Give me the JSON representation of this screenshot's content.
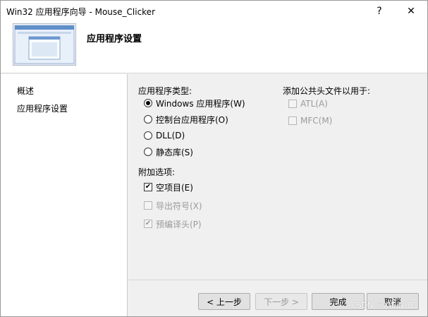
{
  "window": {
    "title": "Win32 应用程序向导 - Mouse_Clicker",
    "help_label": "?",
    "close_label": "✕"
  },
  "header": {
    "title": "应用程序设置"
  },
  "sidebar": {
    "items": [
      {
        "label": "概述"
      },
      {
        "label": "应用程序设置"
      }
    ]
  },
  "app_type": {
    "label": "应用程序类型:",
    "options": [
      {
        "label": "Windows 应用程序(W)",
        "checked": true
      },
      {
        "label": "控制台应用程序(O)",
        "checked": false
      },
      {
        "label": "DLL(D)",
        "checked": false
      },
      {
        "label": "静态库(S)",
        "checked": false
      }
    ]
  },
  "extra_options": {
    "label": "附加选项:",
    "items": [
      {
        "label": "空项目(E)",
        "checked": true,
        "enabled": true
      },
      {
        "label": "导出符号(X)",
        "checked": false,
        "enabled": false
      },
      {
        "label": "预编译头(P)",
        "checked": true,
        "enabled": false
      }
    ]
  },
  "headers": {
    "label": "添加公共头文件以用于:",
    "items": [
      {
        "label": "ATL(A)",
        "checked": false,
        "enabled": false
      },
      {
        "label": "MFC(M)",
        "checked": false,
        "enabled": false
      }
    ]
  },
  "buttons": {
    "back": "< 上一步",
    "next": "下一步 >",
    "finish": "完成",
    "cancel": "取消"
  },
  "watermark": "CSDN @XIE.NUE"
}
